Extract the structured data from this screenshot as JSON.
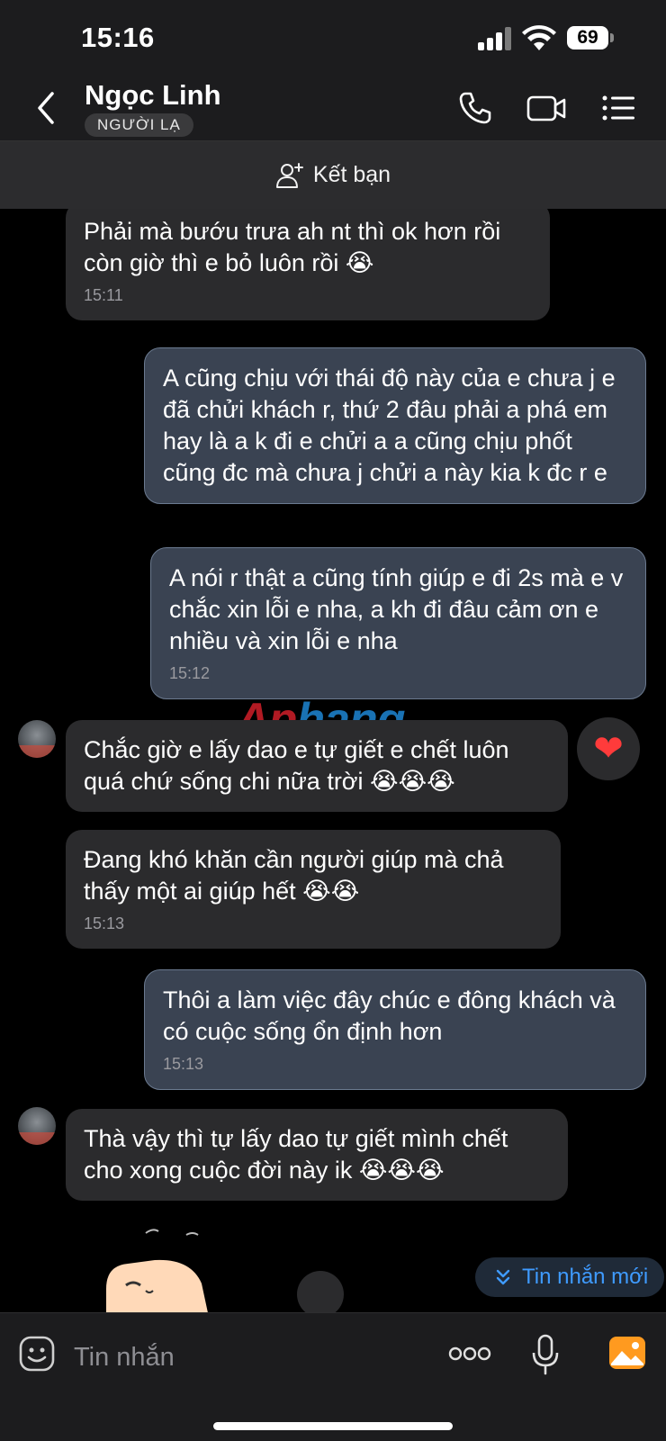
{
  "status": {
    "time": "15:16",
    "battery": "69"
  },
  "header": {
    "contact_name": "Ngọc Linh",
    "badge": "NGƯỜI LẠ"
  },
  "add_friend": {
    "label": "Kết bạn"
  },
  "messages": [
    {
      "direction": "in",
      "text": "Phải mà bướu trưa ah nt thì ok hơn rồi còn giờ thì e bỏ luôn rồi 😭",
      "time": "15:11"
    },
    {
      "direction": "out",
      "text": "A cũng chịu với thái độ này của e chưa j e đã chửi khách r, thứ 2 đâu phải a phá em hay là a k đi e chửi a a cũng chịu phốt cũng đc mà chưa j chửi a này kia k đc r e",
      "time": ""
    },
    {
      "direction": "out",
      "text": "A nói r thật a cũng tính giúp e đi 2s mà e v chắc xin lỗi e nha, a kh đi đâu cảm ơn e nhiều và xin lỗi e nha",
      "time": "15:12"
    },
    {
      "direction": "in",
      "text": "Chắc giờ e lấy dao e tự giết e chết luôn quá chứ sống chi nữa trời 😭😭😭",
      "time": "",
      "reaction": "heart"
    },
    {
      "direction": "in",
      "text": "Đang khó khăn cần người giúp mà chả thấy một ai giúp hết 😭😭",
      "time": "15:13"
    },
    {
      "direction": "out",
      "text": "Thôi a làm việc đây chúc e đông khách và có cuộc sống ổn định hơn",
      "time": "15:13"
    },
    {
      "direction": "in",
      "text": "Thà vậy thì tự lấy dao tự giết mình chết cho xong cuộc đời này ik 😭😭😭",
      "time": ""
    }
  ],
  "watermark": {
    "part1": "Ap",
    "part2": "hang"
  },
  "new_messages_pill": {
    "label": "Tin nhắn mới"
  },
  "composer": {
    "placeholder": "Tin nhắn"
  },
  "icons": {
    "back": "chevron-left-icon",
    "call": "phone-icon",
    "video": "video-camera-icon",
    "menu": "list-menu-icon",
    "add_friend": "add-user-icon",
    "reaction": "heart-icon",
    "sticker": "sticker-icon",
    "more": "more-dots-icon",
    "mic": "microphone-icon",
    "image": "image-icon"
  },
  "colors": {
    "incoming_bubble": "#2b2b2d",
    "outgoing_bubble": "#3a4352",
    "accent": "#3f9bff"
  }
}
